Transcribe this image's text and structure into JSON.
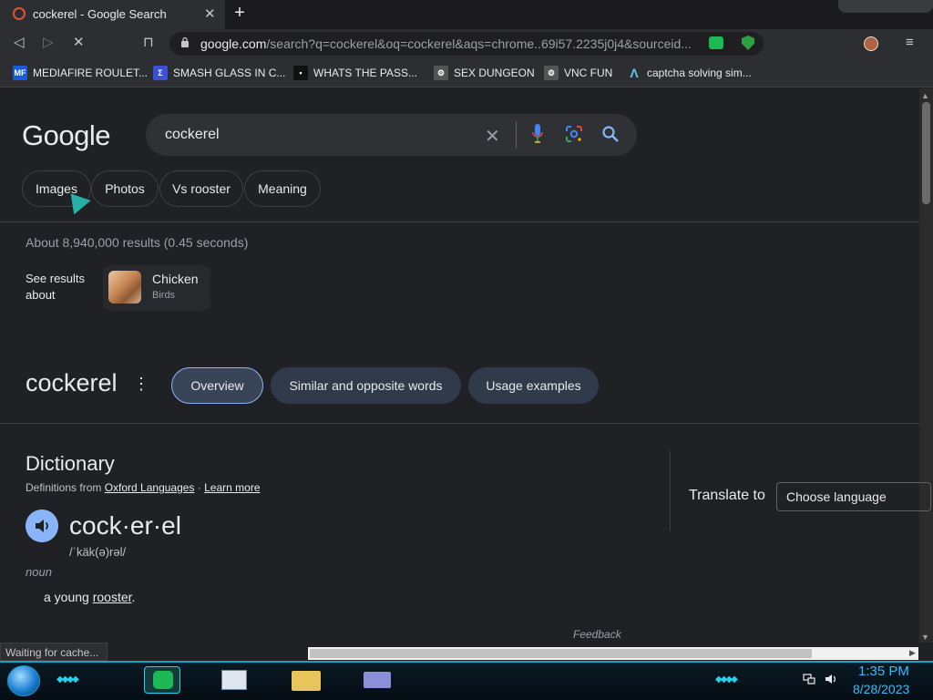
{
  "tab": {
    "title": "cockerel - Google Search",
    "close": "✕"
  },
  "new_tab": "+",
  "toolbar": {
    "back": "◁",
    "forward": "▷",
    "reload": "✕",
    "bookmark": "⊓",
    "url_host": "google.com",
    "url_rest": "/search?q=cockerel&oq=cockerel&aqs=chrome..69i57.2235j0j4&sourceid...",
    "menu": "≡"
  },
  "bookmarks": [
    {
      "label": "MEDIAFIRE ROULET...",
      "icon": "mediafire-icon",
      "color": "#1a5cd8"
    },
    {
      "label": "SMASH GLASS IN C...",
      "icon": "smash-icon",
      "color": "#3d4fd8"
    },
    {
      "label": "WHATS THE PASS...",
      "icon": "robot-icon",
      "color": "#111111"
    },
    {
      "label": "SEX DUNGEON",
      "icon": "dungeon-icon",
      "color": "#888888"
    },
    {
      "label": "VNC FUN",
      "icon": "vnc-icon",
      "color": "#888888"
    },
    {
      "label": "captcha solving sim...",
      "icon": "arc-icon",
      "color": "#5ec8f0"
    }
  ],
  "search": {
    "logo": "Google",
    "query": "cockerel",
    "clear": "✕"
  },
  "chips": [
    "Images",
    "Photos",
    "Vs rooster",
    "Meaning"
  ],
  "results": {
    "stats": "About 8,940,000 results (0.45 seconds)",
    "see_results_about": "See results about",
    "entity_title": "Chicken",
    "entity_subtitle": "Birds"
  },
  "word": {
    "title": "cockerel",
    "menu": "⋮",
    "pills": [
      "Overview",
      "Similar and opposite words",
      "Usage examples"
    ]
  },
  "dictionary": {
    "heading": "Dictionary",
    "from_prefix": "Definitions from ",
    "source": "Oxford Languages",
    "separator": " · ",
    "learn_more": "Learn more",
    "translate_label": "Translate to",
    "language_placeholder": "Choose language",
    "pronounced": "cock·er·el",
    "phonetic": "/ˈkäk(ə)rəl/",
    "part_of_speech": "noun",
    "definition_prefix": "a young ",
    "definition_link": "rooster",
    "definition_suffix": ".",
    "feedback": "Feedback"
  },
  "status_bar": {
    "text": "Waiting for cache..."
  },
  "taskbar": {
    "clock_time": "1:35 PM",
    "clock_date": "8/28/2023"
  },
  "colors": {
    "accent": "#8ab4f8",
    "taskbar_accent": "#22d3ee"
  }
}
